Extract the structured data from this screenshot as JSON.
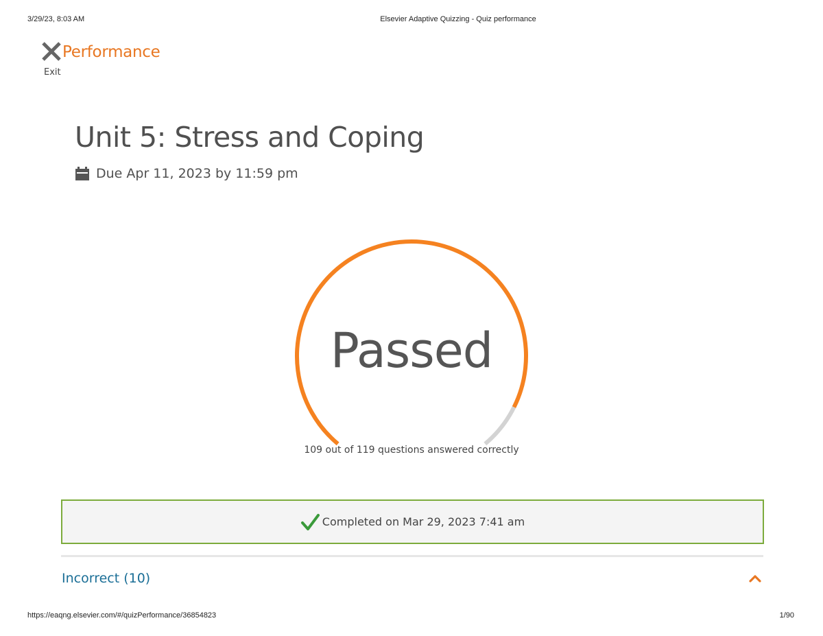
{
  "print_header": {
    "date": "3/29/23, 8:03 AM",
    "page_title": "Elsevier Adaptive Quizzing - Quiz performance"
  },
  "print_footer": {
    "url": "https://eaqng.elsevier.com/#/quizPerformance/36854823",
    "page_number": "1/90"
  },
  "nav": {
    "exit_label": "Exit",
    "section_label": "Performance",
    "close_icon": "close-x-icon"
  },
  "quiz": {
    "title": "Unit 5: Stress and Coping",
    "due_text": "Due Apr 11, 2023 by 11:59 pm",
    "due_icon": "calendar-icon"
  },
  "result": {
    "status": "Passed",
    "score_text": "109 out of 119 questions answered correctly",
    "correct": 109,
    "total": 119,
    "arc_color": "#f58220",
    "track_color": "#d3d3d3"
  },
  "completion": {
    "text": "Completed on Mar 29, 2023 7:41 am",
    "icon": "checkmark-icon",
    "border_color": "#7cab3c",
    "check_color": "#3a9a3a"
  },
  "sections": [
    {
      "label": "Incorrect (10)",
      "icon": "chevron-up-icon",
      "expanded": true
    }
  ],
  "colors": {
    "brand_orange": "#e87722",
    "link_blue": "#1a6e96"
  }
}
